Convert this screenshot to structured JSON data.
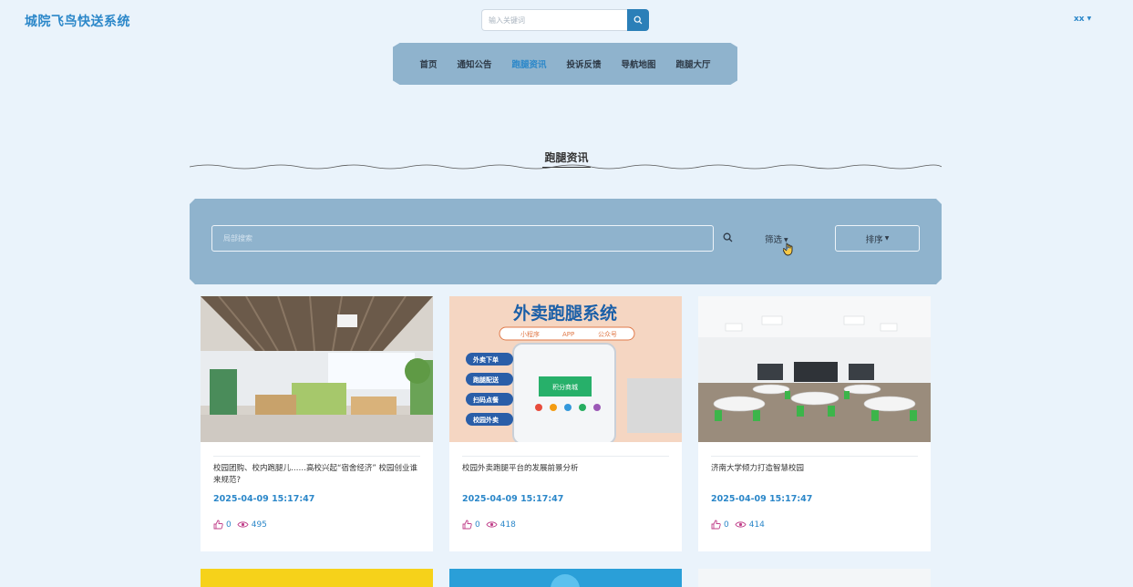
{
  "header": {
    "logo": "城院飞鸟快送系统",
    "search_placeholder": "输入关键词",
    "user_name": "xx"
  },
  "nav": {
    "items": [
      "首页",
      "通知公告",
      "跑腿资讯",
      "投诉反馈",
      "导航地图",
      "跑腿大厅"
    ],
    "active_index": 2
  },
  "section": {
    "title": "跑腿资讯"
  },
  "filters": {
    "search_placeholder": "局部搜索",
    "filter_label": "筛选",
    "sort_label": "排序"
  },
  "cards": [
    {
      "title": "校园团购、校内跑腿儿……高校兴起“宿舍经济” 校园创业谁来规范?",
      "date": "2025-04-09 15:17:47",
      "likes": "0",
      "views": "495"
    },
    {
      "title": "校园外卖跑腿平台的发展前景分析",
      "date": "2025-04-09 15:17:47",
      "likes": "0",
      "views": "418",
      "image_text": {
        "headline": "外卖跑腿系统",
        "tags": [
          "小程序",
          "APP",
          "公众号"
        ],
        "features": [
          "外卖下单",
          "跑腿配送",
          "扫码点餐",
          "校园外卖"
        ],
        "screen": "积分商城"
      }
    },
    {
      "title": "济南大学倾力打造智慧校园",
      "date": "2025-04-09 15:17:47",
      "likes": "0",
      "views": "414"
    }
  ],
  "colors": {
    "accent": "#2b87c9",
    "panel": "#8fb3cd",
    "background": "#eaf3fb"
  }
}
